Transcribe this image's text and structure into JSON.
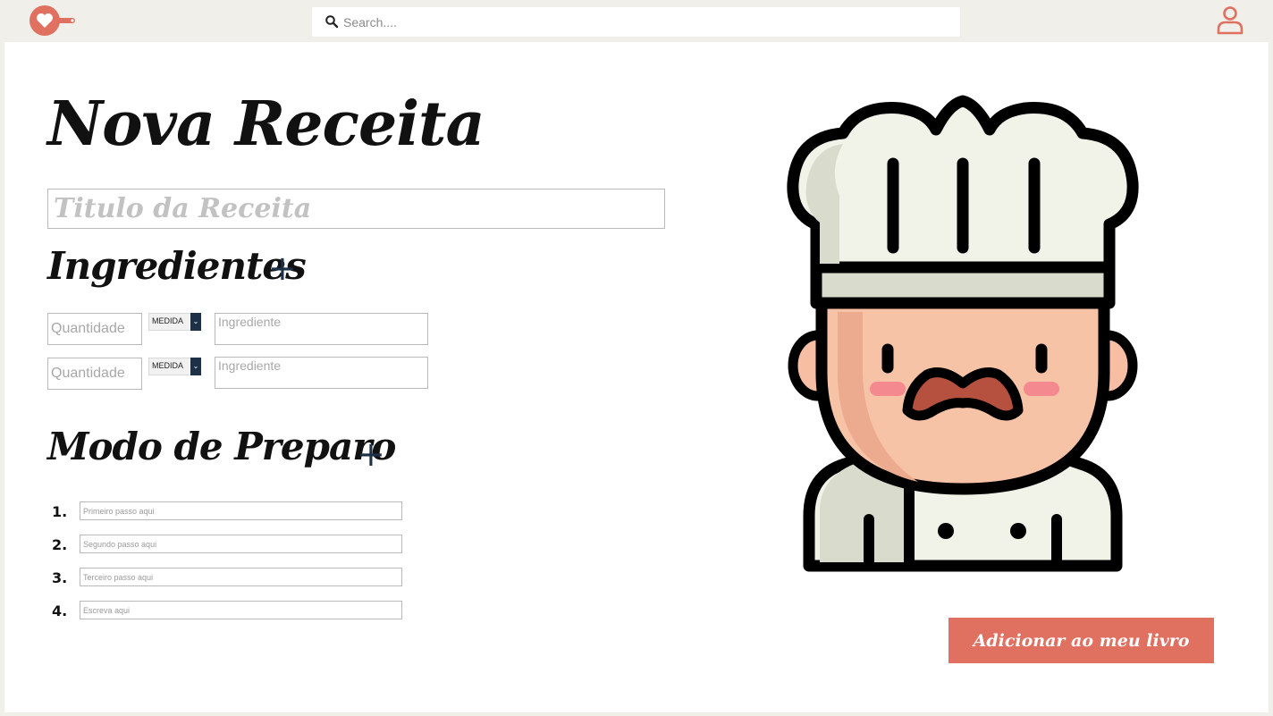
{
  "header": {
    "search": {
      "placeholder": "Search...."
    },
    "icons": {
      "logo": "heart-pan-logo",
      "search": "search-icon",
      "user": "user-icon"
    }
  },
  "form": {
    "page_title": "Nova Receita",
    "title_placeholder": "Titulo da Receita",
    "ingredients": {
      "heading": "Ingredientes",
      "add_symbol": "+",
      "rows": [
        {
          "quantity_placeholder": "Quantidade",
          "measure_label": "MEDIDA",
          "ingredient_placeholder": "Ingrediente"
        },
        {
          "quantity_placeholder": "Quantidade",
          "measure_label": "MEDIDA",
          "ingredient_placeholder": "Ingrediente"
        }
      ]
    },
    "steps": {
      "heading": "Modo de Preparo",
      "add_symbol": "+",
      "items": [
        {
          "number": "1.",
          "placeholder": "Primeiro passo aqui"
        },
        {
          "number": "2.",
          "placeholder": "Segundo passo aqui"
        },
        {
          "number": "3.",
          "placeholder": "Terceiro passo aqui"
        },
        {
          "number": "4.",
          "placeholder": "Escreva aqui"
        }
      ]
    },
    "submit_label": "Adicionar ao meu livro"
  },
  "colors": {
    "accent": "#e07060",
    "navy": "#1d3046",
    "header_bg": "#f1efea"
  }
}
